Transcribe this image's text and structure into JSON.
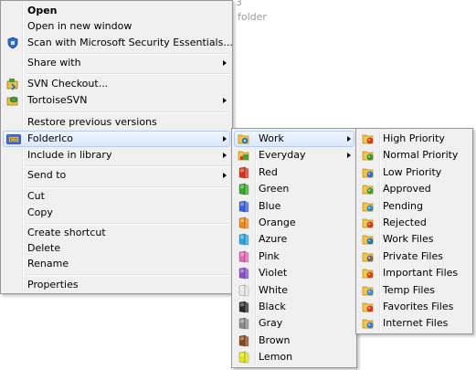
{
  "background": {
    "partial_title": "3",
    "partial_subtitle": "folder"
  },
  "colors": {
    "highlight_bg": "#d9e8fb",
    "menu_bg": "#f0f0f0",
    "border": "#979797"
  },
  "menu1": {
    "items": [
      {
        "label": "Open",
        "bold": true
      },
      {
        "label": "Open in new window"
      },
      {
        "label": "Scan with Microsoft Security Essentials...",
        "icon": "security-essentials-icon"
      },
      {
        "label": "Share with",
        "submenu": true
      },
      {
        "label": "SVN Checkout...",
        "icon": "svn-checkout-icon"
      },
      {
        "label": "TortoiseSVN",
        "icon": "tortoisesvn-icon",
        "submenu": true
      },
      {
        "label": "Restore previous versions"
      },
      {
        "label": "FolderIco",
        "icon": "foldērico-icon",
        "submenu": true,
        "highlighted": true
      },
      {
        "label": "Include in library",
        "submenu": true
      },
      {
        "label": "Send to",
        "submenu": true
      },
      {
        "label": "Cut"
      },
      {
        "label": "Copy"
      },
      {
        "label": "Create shortcut"
      },
      {
        "label": "Delete"
      },
      {
        "label": "Rename"
      },
      {
        "label": "Properties"
      }
    ]
  },
  "menu2": {
    "items": [
      {
        "label": "Work",
        "submenu": true,
        "highlighted": true,
        "icon": "work-folder-icon"
      },
      {
        "label": "Everyday",
        "submenu": true,
        "icon": "everyday-folder-icon"
      },
      {
        "label": "Red",
        "color": "#d9361f"
      },
      {
        "label": "Green",
        "color": "#39a829"
      },
      {
        "label": "Blue",
        "color": "#3b63d8"
      },
      {
        "label": "Orange",
        "color": "#ef8a17"
      },
      {
        "label": "Azure",
        "color": "#2aa8e0"
      },
      {
        "label": "Pink",
        "color": "#e765b9"
      },
      {
        "label": "Violet",
        "color": "#8a4fc9"
      },
      {
        "label": "White",
        "color": "#e9e9e9"
      },
      {
        "label": "Black",
        "color": "#2b2b2b"
      },
      {
        "label": "Gray",
        "color": "#8c8c8c"
      },
      {
        "label": "Brown",
        "color": "#8b4a1c"
      },
      {
        "label": "Lemon",
        "color": "#e6e51a"
      }
    ]
  },
  "menu3": {
    "items": [
      {
        "label": "High Priority",
        "badge": "#d93a1a"
      },
      {
        "label": "Normal Priority",
        "badge": "#2f9a2f"
      },
      {
        "label": "Low Priority",
        "badge": "#2f6fd3"
      },
      {
        "label": "Approved",
        "badge": "#35a435"
      },
      {
        "label": "Pending",
        "badge": "#2a8fd6"
      },
      {
        "label": "Rejected",
        "badge": "#d63b24"
      },
      {
        "label": "Work Files",
        "badge": "#1e73be"
      },
      {
        "label": "Private Files",
        "badge": "#6b6b6b"
      },
      {
        "label": "Important Files",
        "badge": "#e53b1d"
      },
      {
        "label": "Temp Files",
        "badge": "#3a8fd9"
      },
      {
        "label": "Favorites Files",
        "badge": "#e3302f"
      },
      {
        "label": "Internet Files",
        "badge": "#2f86d8"
      }
    ]
  }
}
